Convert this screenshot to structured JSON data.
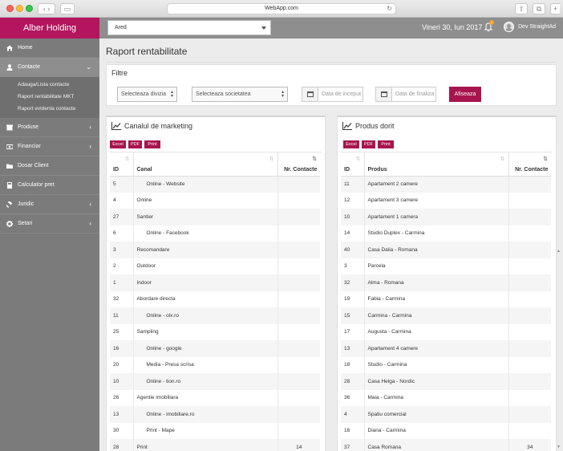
{
  "browser": {
    "url": "WebApp.com"
  },
  "app": {
    "brand": "Alber Holding",
    "area_select": "Ared",
    "date": "Vineri 30, Iun 2017",
    "notification_count": "1",
    "user": "Dev StraightAd"
  },
  "sidebar": {
    "items": [
      {
        "label": "Home",
        "icon": "home-icon"
      },
      {
        "label": "Contacte",
        "icon": "user-icon",
        "active": true,
        "submenu": [
          "Adauga/Lista contacte",
          "Raport rentabilitate MKT",
          "Raport evidenta contacte"
        ]
      },
      {
        "label": "Produse",
        "icon": "box-icon"
      },
      {
        "label": "Financiar",
        "icon": "money-icon"
      },
      {
        "label": "Dosar Client",
        "icon": "folder-icon"
      },
      {
        "label": "Calculator pret",
        "icon": "calculator-icon"
      },
      {
        "label": "Juridic",
        "icon": "gavel-icon"
      },
      {
        "label": "Setari",
        "icon": "gear-icon"
      }
    ]
  },
  "page": {
    "title": "Raport rentabilitate"
  },
  "filters": {
    "title": "Filtre",
    "division": "Selecteaza divizia",
    "company": "Selecteaza societatea",
    "start_date": "Data de inceput",
    "end_date": "Data de finaliza",
    "show_button": "Afiseaza"
  },
  "export_buttons": [
    "Excel",
    "PDF",
    "Print"
  ],
  "marketing_panel": {
    "title": "Canalul de marketing",
    "columns": [
      "ID",
      "Canal",
      "Nr. Contacte"
    ],
    "rows": [
      {
        "id": "5",
        "name": "Online - Website",
        "count": "",
        "indent": true
      },
      {
        "id": "4",
        "name": "Online",
        "count": ""
      },
      {
        "id": "27",
        "name": "Santier",
        "count": ""
      },
      {
        "id": "6",
        "name": "Online - Facebook",
        "count": "",
        "indent": true
      },
      {
        "id": "3",
        "name": "Recomandare",
        "count": ""
      },
      {
        "id": "2",
        "name": "Outdoor",
        "count": ""
      },
      {
        "id": "1",
        "name": "Indoor",
        "count": ""
      },
      {
        "id": "32",
        "name": "Abordare directa",
        "count": ""
      },
      {
        "id": "11",
        "name": "Online - olx.ro",
        "count": "",
        "indent": true
      },
      {
        "id": "25",
        "name": "Sampling",
        "count": ""
      },
      {
        "id": "16",
        "name": "Online - google",
        "count": "",
        "indent": true
      },
      {
        "id": "20",
        "name": "Media - Presa scrisa",
        "count": "",
        "indent": true
      },
      {
        "id": "10",
        "name": "Online - tion.ro",
        "count": "",
        "indent": true
      },
      {
        "id": "26",
        "name": "Agentie imobiliara",
        "count": ""
      },
      {
        "id": "13",
        "name": "Online - imobiliare.ro",
        "count": "",
        "indent": true
      },
      {
        "id": "30",
        "name": "Print - Mape",
        "count": "",
        "indent": true
      },
      {
        "id": "28",
        "name": "Print",
        "count": "14"
      }
    ]
  },
  "product_panel": {
    "title": "Produs dorit",
    "columns": [
      "ID",
      "Produs",
      "Nr. Contacte"
    ],
    "rows": [
      {
        "id": "11",
        "name": "Apartament 2 camere",
        "count": ""
      },
      {
        "id": "12",
        "name": "Apartament 3 camere",
        "count": ""
      },
      {
        "id": "10",
        "name": "Apartament 1 camera",
        "count": ""
      },
      {
        "id": "14",
        "name": "Studio Duplex - Carmina",
        "count": ""
      },
      {
        "id": "40",
        "name": "Casa Dalia - Romana",
        "count": ""
      },
      {
        "id": "3",
        "name": "Parcela",
        "count": ""
      },
      {
        "id": "32",
        "name": "Alma - Romana",
        "count": ""
      },
      {
        "id": "19",
        "name": "Fabia - Carmina",
        "count": ""
      },
      {
        "id": "15",
        "name": "Carmina - Carmina",
        "count": ""
      },
      {
        "id": "17",
        "name": "Augusta - Carmina",
        "count": ""
      },
      {
        "id": "13",
        "name": "Apartament 4 camere",
        "count": ""
      },
      {
        "id": "18",
        "name": "Studio - Carmina",
        "count": ""
      },
      {
        "id": "28",
        "name": "Casa Helga - Nordic",
        "count": ""
      },
      {
        "id": "36",
        "name": "Maia - Carmina",
        "count": ""
      },
      {
        "id": "4",
        "name": "Spatiu comercial",
        "count": ""
      },
      {
        "id": "16",
        "name": "Diana - Carmina",
        "count": ""
      },
      {
        "id": "37",
        "name": "Casa Romana",
        "count": "34"
      }
    ]
  },
  "colors": {
    "brand": "#b4155e",
    "accent": "#a8144e",
    "topbar": "#8e8e8e",
    "sidebar": "#7b7b7b"
  }
}
